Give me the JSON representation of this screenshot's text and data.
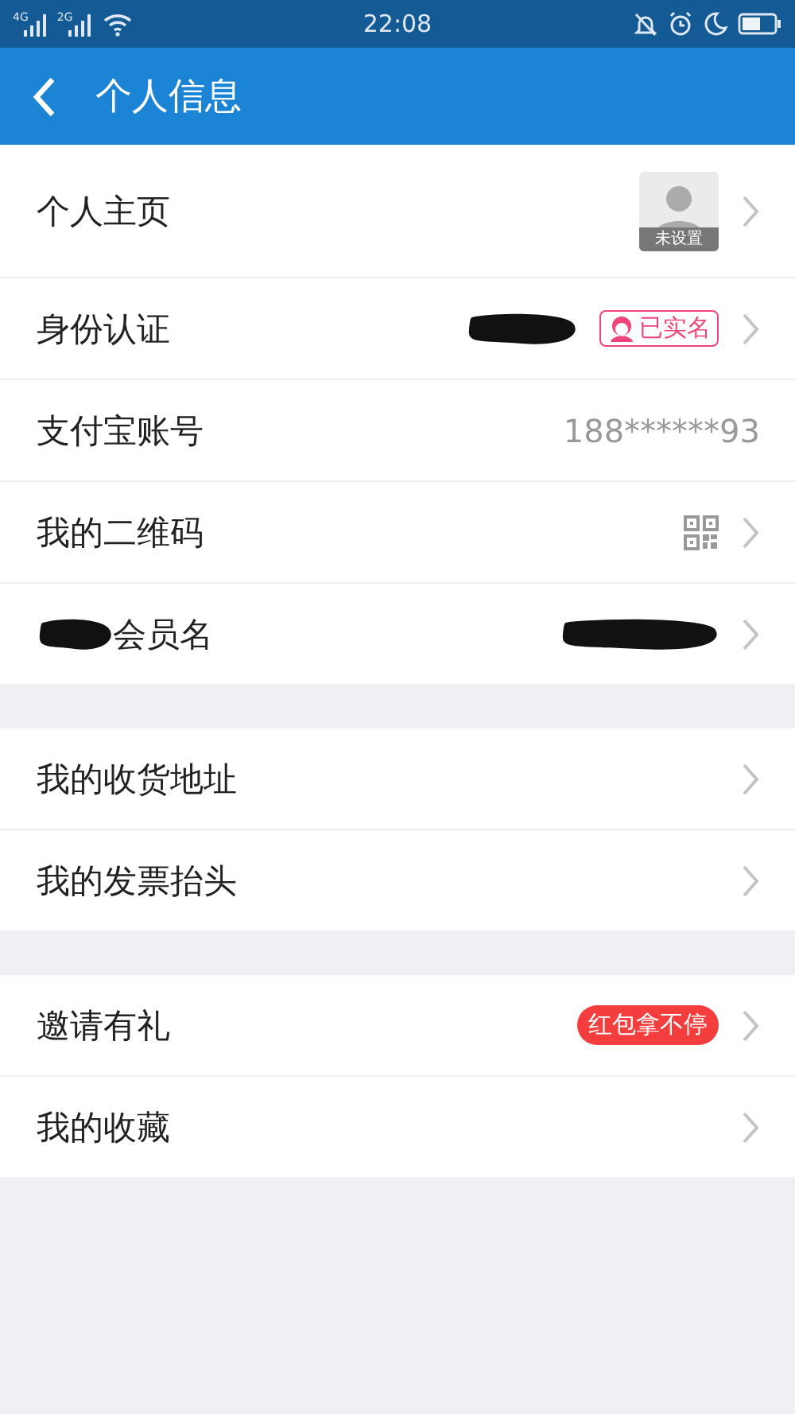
{
  "status_bar": {
    "network_1": "4G",
    "network_2": "2G",
    "time": "22:08"
  },
  "header": {
    "title": "个人信息"
  },
  "groups": [
    {
      "rows": [
        {
          "label": "个人主页",
          "kind": "avatar",
          "avatar_caption": "未设置",
          "arrow": true
        },
        {
          "label": "身份认证",
          "kind": "verified",
          "redacted_value": true,
          "badge": "已实名",
          "arrow": true
        },
        {
          "label": "支付宝账号",
          "kind": "text",
          "value": "188******93",
          "arrow": false
        },
        {
          "label": "我的二维码",
          "kind": "qr",
          "arrow": true
        },
        {
          "label": "会员名",
          "kind": "none",
          "redacted_prefix": true,
          "redacted_value": true,
          "arrow": true
        }
      ]
    },
    {
      "rows": [
        {
          "label": "我的收货地址",
          "kind": "none",
          "arrow": true
        },
        {
          "label": "我的发票抬头",
          "kind": "none",
          "arrow": true
        }
      ]
    },
    {
      "rows": [
        {
          "label": "邀请有礼",
          "kind": "promo",
          "badge": "红包拿不停",
          "arrow": true
        },
        {
          "label": "我的收藏",
          "kind": "none",
          "arrow": true
        }
      ]
    }
  ]
}
